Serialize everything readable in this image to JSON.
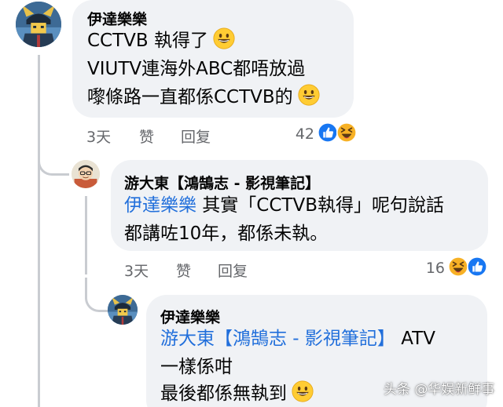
{
  "comments": [
    {
      "author": "伊達樂樂",
      "lines": [
        "CCTVB 執得了",
        "VIUTV連海外ABC都唔放過",
        "嚟條路一直都係CCTVB的"
      ],
      "emoji": "grinning-face-icon",
      "time": "3天",
      "like_label": "赞",
      "reply_label": "回复",
      "reaction_count": "42",
      "reactions": [
        "like-reaction-icon",
        "haha-reaction-icon"
      ]
    },
    {
      "author": "游大東【鴻鵠志 - 影視筆記】",
      "mention": "伊達樂樂",
      "line1_rest": " 其實「CCTVB執得」呢句說話",
      "line2": "都講咗10年，都係未執。",
      "time": "3天",
      "like_label": "赞",
      "reply_label": "回复",
      "reaction_count": "16",
      "reactions": [
        "haha-reaction-icon",
        "like-reaction-icon"
      ]
    },
    {
      "author": "伊達樂樂",
      "mention": "游大東【鴻鵠志 - 影視筆記】",
      "line1_rest": " ATV",
      "line2": "一樣係咁",
      "line3": "最後都係無執到",
      "emoji": "grinning-face-icon"
    }
  ],
  "watermark": "头条 @华娱新鲜事",
  "colors": {
    "bubble": "#f0f2f5",
    "mention": "#216fdb",
    "meta": "#65676b",
    "like_blue": "#1877f2",
    "haha_yellow": "#f7b125"
  }
}
